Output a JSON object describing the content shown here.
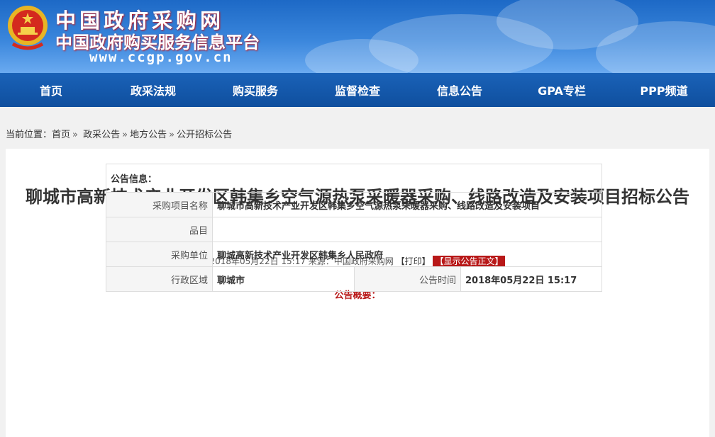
{
  "header": {
    "site_title": "中国政府采购网",
    "site_subtitle": "中国政府购买服务信息平台",
    "site_url": "www.ccgp.gov.cn",
    "brand_color": "#1a62b8"
  },
  "nav": {
    "items": [
      {
        "label": "首页"
      },
      {
        "label": "政采法规"
      },
      {
        "label": "购买服务"
      },
      {
        "label": "监督检查"
      },
      {
        "label": "信息公告"
      },
      {
        "label": "GPA专栏"
      },
      {
        "label": "PPP频道"
      }
    ]
  },
  "breadcrumb": {
    "prefix": "当前位置：",
    "items": [
      "首页",
      "政采公告",
      "地方公告",
      "公开招标公告"
    ],
    "separator": "»"
  },
  "article": {
    "title": "聊城市高新技术产业开发区韩集乡空气源热泵采暖器采购、线路改造及安装项目招标公告",
    "meta_text": "2018年05月22日 15:17 来源：中国政府采购网",
    "print_label": "【打印】",
    "show_body_label": "【显示公告正文】",
    "summary_title": "公告概要："
  },
  "info_table": {
    "header": "公告信息：",
    "rows": {
      "project_name_label": "采购项目名称",
      "project_name_value": "聊城市高新技术产业开发区韩集乡空气源热泵采暖器采购、线路改造及安装项目",
      "item_label": "品目",
      "item_value": "",
      "buyer_label": "采购单位",
      "buyer_value": "聊城高新技术产业开发区韩集乡人民政府",
      "region_label": "行政区域",
      "region_value": "聊城市",
      "time_label": "公告时间",
      "time_value": "2018年05月22日 15:17"
    }
  }
}
